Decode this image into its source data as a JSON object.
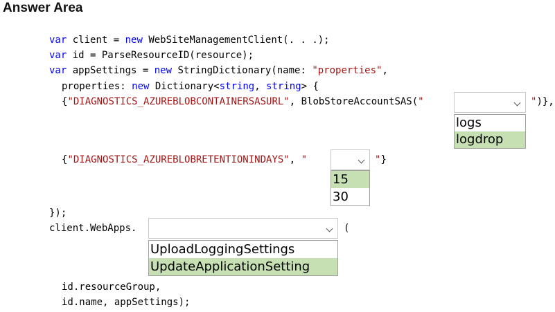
{
  "title": "Answer Area",
  "code": {
    "line1": {
      "kw1": "var",
      "a": " client = ",
      "kw2": "new",
      "b": " WebSiteManagementClient(. . .);"
    },
    "line2": {
      "kw1": "var",
      "a": " id = ParseResourceID(resource);"
    },
    "line3": {
      "kw1": "var",
      "a": " appSettings = ",
      "kw2": "new",
      "b": " StringDictionary(name: ",
      "str1": "\"properties\"",
      "c": ","
    },
    "line4": {
      "a": "properties: ",
      "kw1": "new",
      "b": " Dictionary<",
      "kw2": "string",
      "c": ", ",
      "kw3": "string",
      "d": "> {"
    },
    "line5": {
      "a": "{",
      "str1": "\"DIAGNOSTICS_AZUREBLOBCONTAINERSASURL\"",
      "b": ", BlobStoreAccountSAS(",
      "str2": "\"",
      "end": "\")},"
    },
    "line6": {
      "a": "{",
      "str1": "\"DIAGNOSTICS_AZUREBLOBRETENTIONINDAYS\"",
      "b": ", ",
      "str2": "\"",
      "end": "\"}"
    },
    "line7": {
      "a": "});"
    },
    "line8": {
      "a": "client.WebApps.",
      "end": "("
    },
    "line9": {
      "a": "id.resourceGroup,"
    },
    "line10": {
      "a": "id.name, appSettings);"
    }
  },
  "dropdowns": {
    "container": {
      "value": "",
      "options": [
        {
          "label": "logs",
          "selected": false
        },
        {
          "label": "logdrop",
          "selected": true
        }
      ]
    },
    "retention": {
      "value": "",
      "options": [
        {
          "label": "15",
          "selected": true
        },
        {
          "label": "30",
          "selected": false
        }
      ]
    },
    "method": {
      "value": "",
      "options": [
        {
          "label": "UploadLoggingSettings",
          "selected": false
        },
        {
          "label": "UpdateApplicationSetting",
          "selected": true
        }
      ]
    }
  },
  "colors": {
    "keyword": "#0000ff",
    "string": "#a31515",
    "selected_option": "#c6e0b4"
  }
}
